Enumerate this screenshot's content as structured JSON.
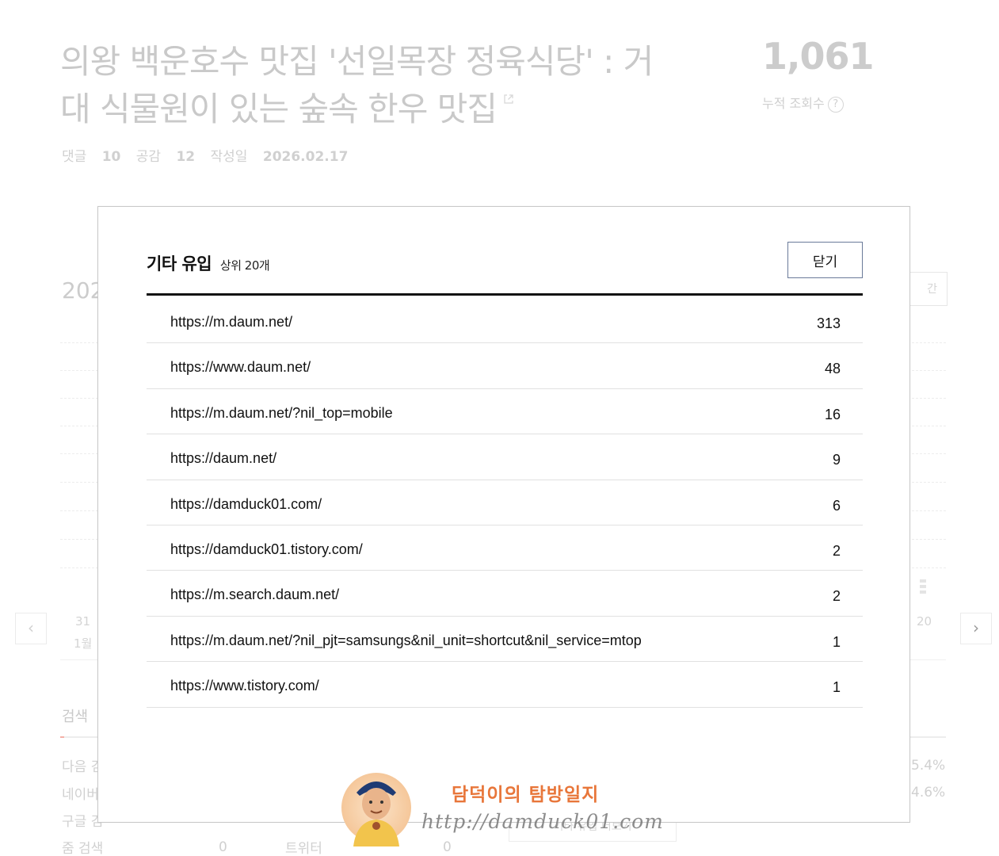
{
  "post": {
    "title": "의왕 백운호수 맛집 '선일목장 정육식당' : 거대 식물원이 있는 숲속 한우 맛집",
    "comments_label": "댓글",
    "comments": "10",
    "likes_label": "공감",
    "likes": "12",
    "date_label": "작성일",
    "date": "2026.02.17"
  },
  "views": {
    "count": "1,061",
    "label": "누적 조회수",
    "help": "?"
  },
  "period": {
    "year_partial": "202",
    "button_partial": "간"
  },
  "chart_axis": {
    "left_day": "31",
    "left_month": "1월",
    "right_day": "20",
    "prev": "‹",
    "next": "›"
  },
  "search": {
    "title": "검색",
    "rows": [
      {
        "label": "다음 검",
        "pct": "5.4%"
      },
      {
        "label": "네이버",
        "pct": "4.6%"
      },
      {
        "label": "구글 검"
      },
      {
        "label": "줌 검색",
        "value": "0",
        "other_label": "트위터",
        "other_value": "0"
      }
    ],
    "more_button": "기타 유입 더보기"
  },
  "modal": {
    "title": "기타 유입",
    "subtitle": "상위 20개",
    "close_label": "닫기",
    "referrers": [
      {
        "url": "https://m.daum.net/",
        "count": "313"
      },
      {
        "url": "https://www.daum.net/",
        "count": "48"
      },
      {
        "url": "https://m.daum.net/?nil_top=mobile",
        "count": "16"
      },
      {
        "url": "https://daum.net/",
        "count": "9"
      },
      {
        "url": "https://damduck01.com/",
        "count": "6"
      },
      {
        "url": "https://damduck01.tistory.com/",
        "count": "2"
      },
      {
        "url": "https://m.search.daum.net/",
        "count": "2"
      },
      {
        "url": "https://m.daum.net/?nil_pjt=samsungs&nil_unit=shortcut&nil_service=mtop",
        "count": "1"
      },
      {
        "url": "https://www.tistory.com/",
        "count": "1"
      }
    ]
  },
  "watermark": {
    "name": "담덕이의 탐방일지",
    "url": "http://damduck01.com"
  },
  "colors": {
    "accent_border": "#6a7a99",
    "watermark_orange": "#e8763a",
    "faded_text": "#c9c9c9"
  }
}
